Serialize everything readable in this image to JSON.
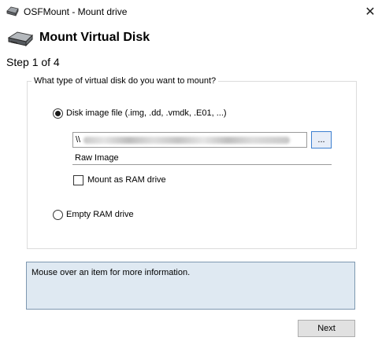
{
  "window": {
    "title": "OSFMount - Mount drive",
    "close_glyph": "✕"
  },
  "header": {
    "title": "Mount Virtual Disk",
    "step": "Step 1 of 4"
  },
  "group": {
    "legend": "What type of virtual disk do you want to mount?"
  },
  "options": {
    "disk_image_label": "Disk image file (.img, .dd, .vmdk, .E01, ...)",
    "disk_image_selected": true,
    "path_value_prefix": "\\\\",
    "browse_label": "...",
    "image_type": "Raw Image",
    "mount_ram_label": "Mount as RAM drive",
    "mount_ram_checked": false,
    "empty_ram_label": "Empty RAM drive",
    "empty_ram_selected": false
  },
  "info": {
    "text": "Mouse over an item for more information."
  },
  "footer": {
    "next_label": "Next"
  },
  "icons": {
    "title_icon": "disk-drive-icon",
    "header_icon": "disk-drive-icon",
    "close_icon": "close-icon"
  },
  "colors": {
    "info_bg": "#dfe9f2",
    "info_border": "#7e98b0",
    "browse_border": "#3c7fd0"
  }
}
